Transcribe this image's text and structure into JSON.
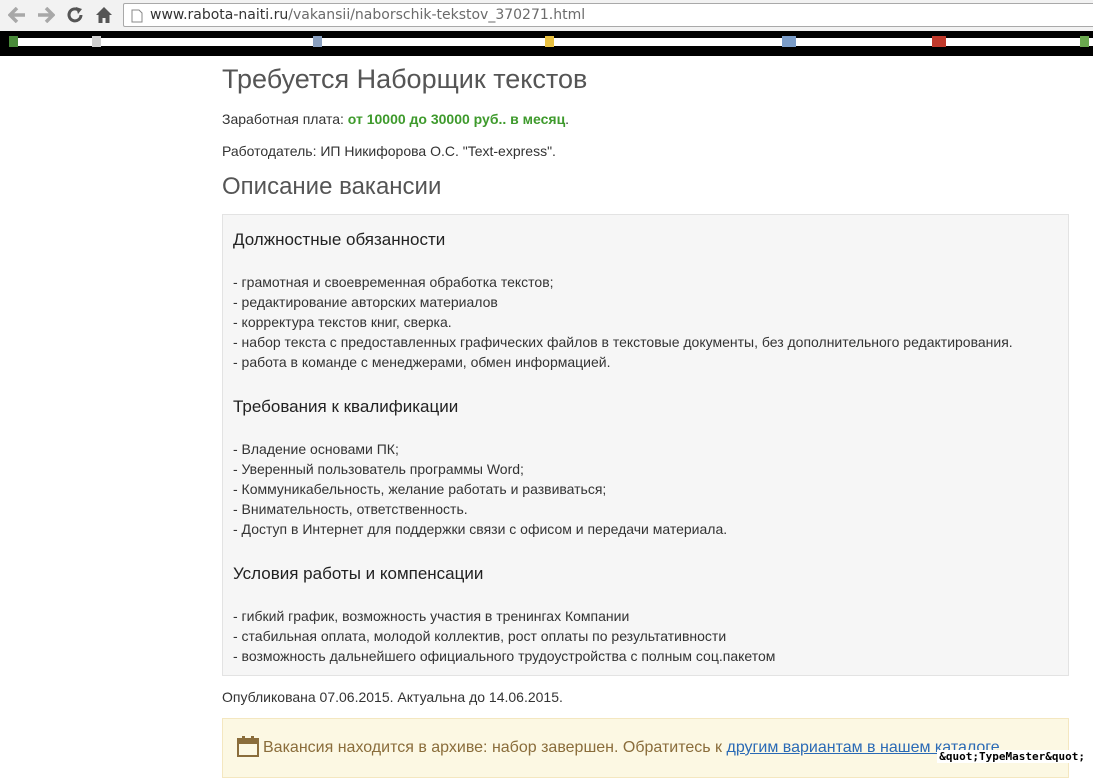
{
  "browser": {
    "url_domain": "www.rabota-naiti.ru",
    "url_path": "/vakansii/naborschik-tekstov_370271.html"
  },
  "page": {
    "title": "Требуется Наборщик текстов",
    "salary_label": "Заработная плата: ",
    "salary_value": "от 10000 до 30000 руб.. в месяц",
    "salary_end": ".",
    "employer": "Работодатель: ИП Никифорова О.С. \"Text-express\".",
    "description_heading": "Описание вакансии",
    "sections": [
      {
        "heading": "Должностные обязанности",
        "items": [
          "- грамотная и своевременная обработка текстов;",
          "- редактирование авторских материалов",
          "- корректура текстов книг, сверка.",
          "- набор текста с предоставленных графических файлов в текстовые документы, без дополнительного редактирования.",
          "- работа в команде с менеджерами, обмен информацией."
        ]
      },
      {
        "heading": "Требования к квалификации",
        "items": [
          "- Владение основами ПК;",
          "- Уверенный пользователь программы Word;",
          "- Коммуникабельность, желание работать и развиваться;",
          "- Внимательность, ответственность.",
          "- Доступ в Интернет для поддержки связи с офисом и передачи материала."
        ]
      },
      {
        "heading": "Условия работы и компенсации",
        "items": [
          "- гибкий график, возможность участия в тренингах Компании",
          "- стабильная оплата, молодой коллектив, рост оплаты по результативности",
          "- возможность дальнейшего официального трудоустройства с полным соц.пакетом"
        ]
      }
    ],
    "published": "Опубликована 07.06.2015. Актуальна до 14.06.2015.",
    "archive_text": "Вакансия находится в архиве: набор завершен. Обратитесь к ",
    "archive_link": "другим вариантам в нашем каталоге",
    "archive_icon": "calendar-icon"
  },
  "watermark": "&quot;TypeMaster&quot;",
  "colors": {
    "salary_green": "#3e9a2c",
    "link_blue": "#2a6ab5",
    "archive_bg": "#fcf8e3"
  }
}
